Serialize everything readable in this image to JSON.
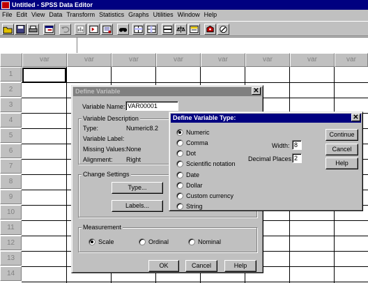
{
  "window": {
    "title": "Untitled - SPSS Data Editor"
  },
  "menu": [
    "File",
    "Edit",
    "View",
    "Data",
    "Transform",
    "Statistics",
    "Graphs",
    "Utilities",
    "Window",
    "Help"
  ],
  "toolbar_icons": [
    "open-icon",
    "save-icon",
    "print-icon",
    "dialog-recall-icon",
    "undo-icon",
    "goto-chart-icon",
    "goto-case-icon",
    "variables-icon",
    "find-icon",
    "insert-case-icon",
    "insert-variable-icon",
    "split-file-icon",
    "weight-cases-icon",
    "select-cases-icon",
    "value-labels-icon",
    "use-sets-icon"
  ],
  "grid": {
    "column_header": "var",
    "columns": [
      "var",
      "var",
      "var",
      "var",
      "var",
      "var",
      "var",
      "var"
    ],
    "rows": [
      "1",
      "2",
      "3",
      "4",
      "5",
      "6",
      "7",
      "8",
      "9",
      "10",
      "11",
      "12",
      "13",
      "14"
    ]
  },
  "define_variable": {
    "title": "Define Variable",
    "close_label": "✕",
    "variable_name_label": "Variable Name:",
    "variable_name_value": "VAR00001",
    "description_group": "Variable Description",
    "type_label": "Type:",
    "type_value": "Numeric8.2",
    "variable_label_label": "Variable Label:",
    "missing_values_label": "Missing Values:",
    "missing_values_value": "None",
    "alignment_label": "Alignment:",
    "alignment_value": "Right",
    "change_settings_group": "Change Settings",
    "type_button": "Type...",
    "labels_button": "Labels...",
    "measurement_group": "Measurement",
    "measurement_options": [
      {
        "label": "Scale",
        "checked": true
      },
      {
        "label": "Ordinal",
        "checked": false
      },
      {
        "label": "Nominal",
        "checked": false
      }
    ],
    "ok_button": "OK",
    "cancel_button": "Cancel",
    "help_button": "Help"
  },
  "define_variable_type": {
    "title": "Define Variable Type:",
    "close_label": "✕",
    "types": [
      {
        "label": "Numeric",
        "checked": true
      },
      {
        "label": "Comma",
        "checked": false
      },
      {
        "label": "Dot",
        "checked": false
      },
      {
        "label": "Scientific notation",
        "checked": false
      },
      {
        "label": "Date",
        "checked": false
      },
      {
        "label": "Dollar",
        "checked": false
      },
      {
        "label": "Custom currency",
        "checked": false
      },
      {
        "label": "String",
        "checked": false
      }
    ],
    "width_label": "Width:",
    "width_value": "8",
    "decimal_label": "Decimal Places:",
    "decimal_value": "2",
    "continue_button": "Continue",
    "cancel_button": "Cancel",
    "help_button": "Help"
  }
}
